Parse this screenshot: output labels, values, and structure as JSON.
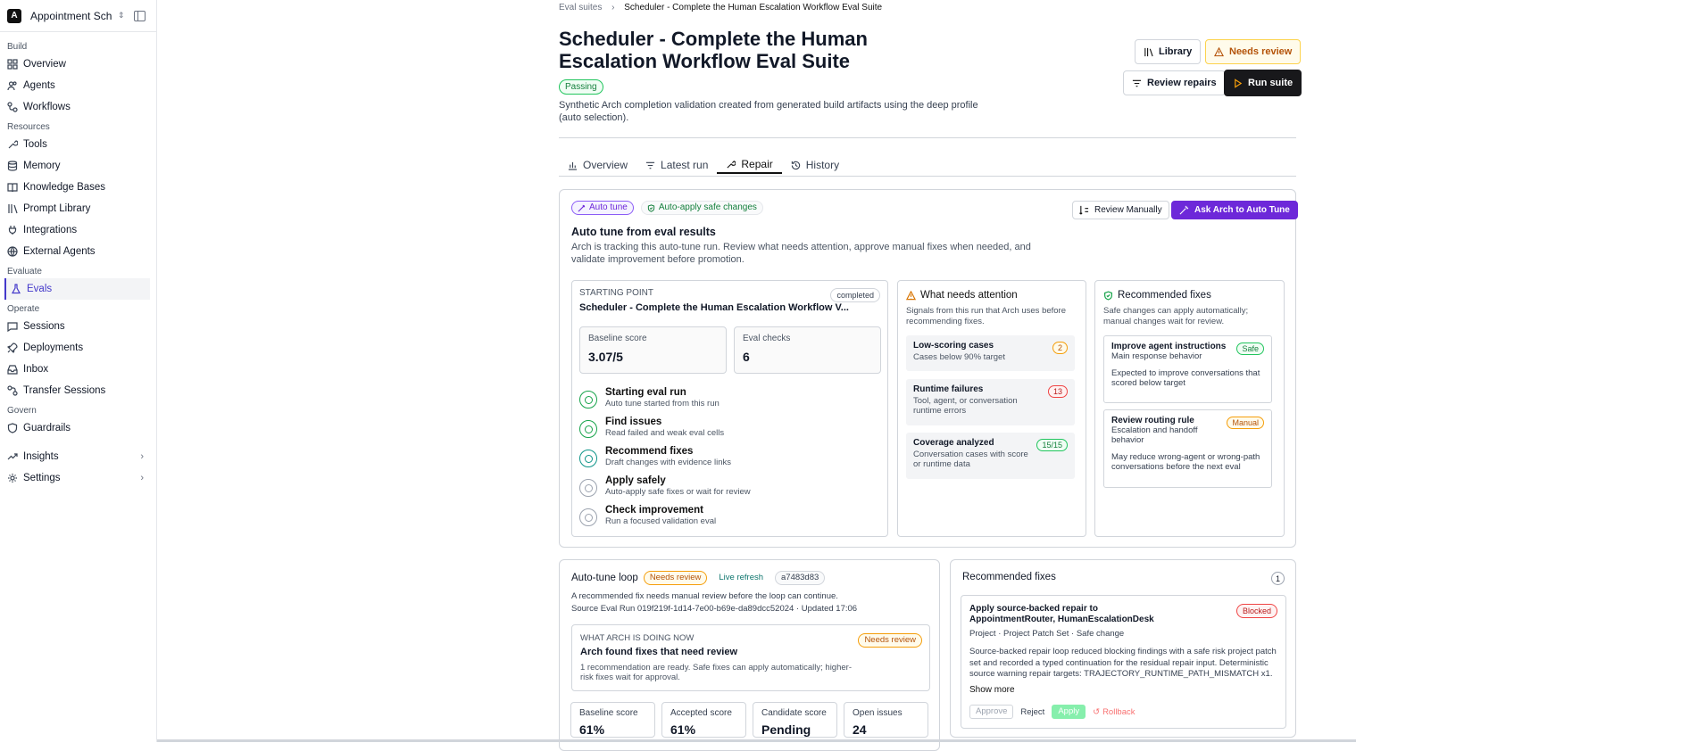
{
  "sidebar": {
    "workspace": "Appointment Sch...",
    "sections": [
      {
        "title": "Build",
        "items": [
          "Overview",
          "Agents",
          "Workflows"
        ]
      },
      {
        "title": "Resources",
        "items": [
          "Tools",
          "Memory",
          "Knowledge Bases",
          "Prompt Library",
          "Integrations",
          "External Agents"
        ]
      },
      {
        "title": "Evaluate",
        "items": [
          "Evals"
        ]
      },
      {
        "title": "Operate",
        "items": [
          "Sessions",
          "Deployments",
          "Inbox",
          "Transfer Sessions"
        ]
      },
      {
        "title": "Govern",
        "items": [
          "Guardrails"
        ]
      }
    ],
    "insights": "Insights",
    "settings": "Settings"
  },
  "breadcrumb": {
    "root": "Eval suites",
    "current": "Scheduler - Complete the Human Escalation Workflow Eval Suite"
  },
  "page": {
    "title": "Scheduler - Complete the Human Escalation Workflow Eval Suite",
    "status": "Passing",
    "description": "Synthetic Arch completion validation created from generated build artifacts using the deep profile (auto selection)."
  },
  "actions": {
    "library": "Library",
    "needs_review": "Needs review",
    "review_repairs": "Review repairs",
    "run_suite": "Run suite"
  },
  "tabs": [
    "Overview",
    "Latest run",
    "Repair",
    "History"
  ],
  "autotune": {
    "tag_auto": "Auto tune",
    "tag_safe": "Auto-apply safe changes",
    "review_manually": "Review Manually",
    "ask_arch": "Ask Arch to Auto Tune",
    "title": "Auto tune from eval results",
    "desc": "Arch is tracking this auto-tune run. Review what needs attention, approve manual fixes when needed, and validate improvement before promotion.",
    "starting": {
      "label": "STARTING POINT",
      "badge": "completed",
      "name": "Scheduler - Complete the Human Escalation Workflow V...",
      "baseline_label": "Baseline score",
      "baseline": "3.07/5",
      "checks_label": "Eval checks",
      "checks": "6"
    },
    "steps": [
      {
        "t": "Starting eval run",
        "d": "Auto tune started from this run",
        "state": "done"
      },
      {
        "t": "Find issues",
        "d": "Read failed and weak eval cells",
        "state": "done"
      },
      {
        "t": "Recommend fixes",
        "d": "Draft changes with evidence links",
        "state": "active"
      },
      {
        "t": "Apply safely",
        "d": "Auto-apply safe fixes or wait for review",
        "state": "pending"
      },
      {
        "t": "Check improvement",
        "d": "Run a focused validation eval",
        "state": "pending"
      }
    ],
    "attention": {
      "title": "What needs attention",
      "desc": "Signals from this run that Arch uses before recommending fixes.",
      "items": [
        {
          "t": "Low-scoring cases",
          "d": "Cases below 90% target",
          "n": "2"
        },
        {
          "t": "Runtime failures",
          "d": "Tool, agent, or conversation runtime errors",
          "n": "13"
        },
        {
          "t": "Coverage analyzed",
          "d": "Conversation cases with score or runtime data",
          "n": "15/15"
        }
      ]
    },
    "fixes": {
      "title": "Recommended fixes",
      "desc": "Safe changes can apply automatically; manual changes wait for review.",
      "items": [
        {
          "t": "Improve agent instructions",
          "sub": "Main response behavior",
          "badge": "Safe",
          "d": "Expected to improve conversations that scored below target"
        },
        {
          "t": "Review routing rule",
          "sub": "Escalation and handoff behavior",
          "badge": "Manual",
          "d": "May reduce wrong-agent or wrong-path conversations before the next eval"
        }
      ]
    }
  },
  "loop": {
    "title": "Auto-tune loop",
    "needs_review": "Needs review",
    "live": "Live refresh",
    "hash": "a7483d83",
    "desc": "A recommended fix needs manual review before the loop can continue.",
    "source": "Source Eval Run 019f219f-1d14-7e00-b69e-da89dcc52024 · Updated 17:06",
    "now_label": "WHAT ARCH IS DOING NOW",
    "now_badge": "Needs review",
    "now_title": "Arch found fixes that need review",
    "now_desc": "1 recommendation are ready. Safe fixes can apply automatically; higher-risk fixes wait for approval.",
    "metrics": [
      {
        "l": "Baseline score",
        "v": "61%"
      },
      {
        "l": "Accepted score",
        "v": "61%"
      },
      {
        "l": "Candidate score",
        "v": "Pending"
      },
      {
        "l": "Open issues",
        "v": "24"
      }
    ]
  },
  "rec": {
    "title": "Recommended fixes",
    "count": "1",
    "item_title": "Apply source-backed repair to AppointmentRouter, HumanEscalationDesk",
    "badge": "Blocked",
    "meta": "Project · Project Patch Set · Safe change",
    "desc": "Source-backed repair loop reduced blocking findings with a safe risk project patch set and recorded a typed continuation for the residual repair input. Deterministic source warning repair targets: TRAJECTORY_RUNTIME_PATH_MISMATCH x1. Residua...",
    "show_more": "Show more",
    "approve": "Approve",
    "reject": "Reject",
    "apply": "Apply",
    "rollback": "Rollback"
  }
}
